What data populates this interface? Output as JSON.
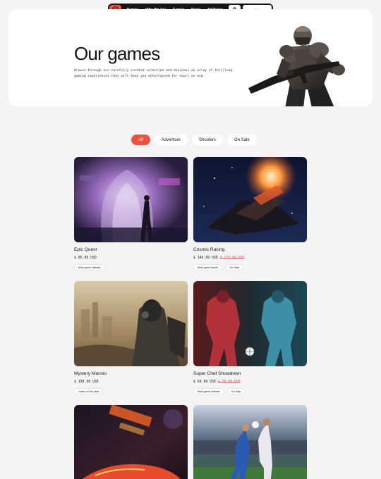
{
  "nav": {
    "links": [
      "Demos",
      "Who We Are",
      "Games",
      "News",
      "All Pages"
    ],
    "cta": "Start for Free"
  },
  "hero": {
    "title": "Our games",
    "description": "Browse through our carefully curated selection and discover an array of thrilling gaming experiences that will keep you entertained for hours on end."
  },
  "filters": [
    "All",
    "Adventure",
    "Shooters",
    "On Sale"
  ],
  "games": [
    {
      "title": "Epic Quest",
      "price": "$ 85.99 USD",
      "old_price": "",
      "tags": [
        "Best game release"
      ]
    },
    {
      "title": "Cosmic Racing",
      "price": "$ 149.99 USD",
      "old_price": "$ 175.99 USD",
      "tags": [
        "Best game studio",
        "On Sale"
      ]
    },
    {
      "title": "Mystery Mansio",
      "price": "$ 199.99 USD",
      "old_price": "",
      "tags": [
        "Game of the year"
      ]
    },
    {
      "title": "Super Chef Showdown",
      "price": "$ 69.99 USD",
      "old_price": "$ 79.99 USD",
      "tags": [
        "Best game release",
        "On Sale"
      ]
    }
  ],
  "colors": {
    "accent": "#e8523f",
    "dark": "#141414",
    "background": "#f4f4f4"
  }
}
